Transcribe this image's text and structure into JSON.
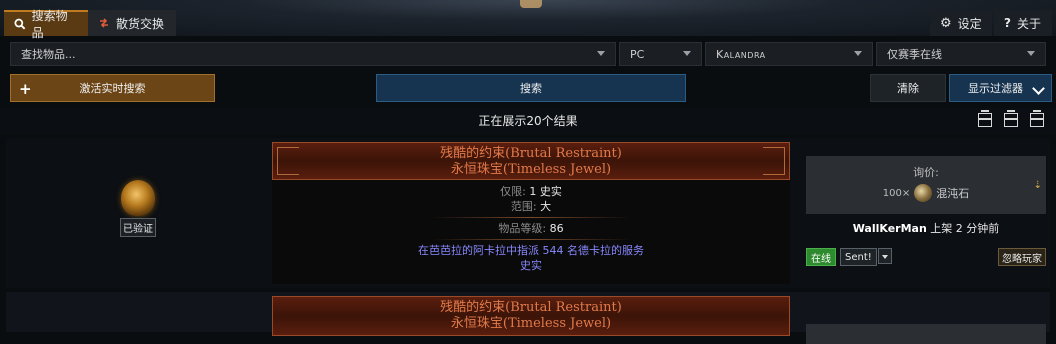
{
  "nav": {
    "search_tab": "搜索物品",
    "exchange_tab": "散货交换",
    "settings": "设定",
    "about": "关于"
  },
  "filters": {
    "search_placeholder": "查找物品...",
    "platform": "PC",
    "league": "Kalandra",
    "online": "仅赛季在线"
  },
  "actions": {
    "live_search": "激活实时搜索",
    "search": "搜索",
    "clear": "清除",
    "show_filters": "显示过滤器"
  },
  "results": {
    "summary": "正在展示20个结果"
  },
  "item": {
    "name": "残酷的约束(Brutal Restraint)",
    "base": "永恒珠宝(Timeless Jewel)",
    "verified": "已验证",
    "props": [
      {
        "key": "仅限: ",
        "value": "1 史实"
      },
      {
        "key": "范围: ",
        "value": "大"
      }
    ],
    "item_level_key": "物品等级: ",
    "item_level_value": "86",
    "mod_line1": "在芭芭拉的阿卡拉中指派 544 名德卡拉的服务",
    "mod_line2": "史实"
  },
  "listing": {
    "price_label": "询价:",
    "price_amount": "100×",
    "currency": "混沌石",
    "seller_name": "WallKerMan",
    "seller_time": " 上架 2 分钟前",
    "status": "在线",
    "sent": "Sent!",
    "ignore": "忽略玩家"
  },
  "item2": {
    "name": "残酷的约束(Brutal Restraint)",
    "base": "永恒珠宝(Timeless Jewel)"
  }
}
